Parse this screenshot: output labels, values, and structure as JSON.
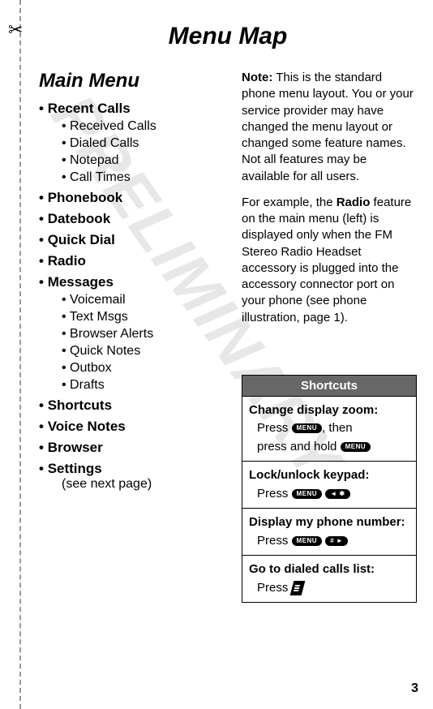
{
  "title": "Menu Map",
  "watermark": "PRELIMINARY",
  "main_heading": "Main Menu",
  "menu": [
    {
      "label": "Recent Calls",
      "sub": [
        "Received Calls",
        "Dialed Calls",
        "Notepad",
        "Call Times"
      ]
    },
    {
      "label": "Phonebook"
    },
    {
      "label": "Datebook"
    },
    {
      "label": "Quick Dial"
    },
    {
      "label": "Radio"
    },
    {
      "label": "Messages",
      "sub": [
        "Voicemail",
        "Text Msgs",
        "Browser Alerts",
        "Quick Notes",
        "Outbox",
        "Drafts"
      ]
    },
    {
      "label": "Shortcuts"
    },
    {
      "label": "Voice Notes"
    },
    {
      "label": "Browser"
    },
    {
      "label": "Settings",
      "note": "(see next page)"
    }
  ],
  "note_label": "Note:",
  "note_text": " This is the standard phone menu layout. You or your service provider may have changed the menu layout or changed some feature names. Not all features may be available for all users.",
  "feature_prefix": "For example, the ",
  "feature_bold": "Radio",
  "feature_suffix": " feature on the main menu (left) is displayed only when the FM Stereo Radio Headset accessory is plugged into the accessory connector port on your phone (see phone illustration, page 1).",
  "shortcuts": {
    "header": "Shortcuts",
    "items": [
      {
        "title": "Change display zoom:",
        "line1_pre": "Press ",
        "key1": "MENU",
        "line1_post": ", then",
        "line2_pre": "press and hold ",
        "key2": "MENU"
      },
      {
        "title": "Lock/unlock keypad:",
        "line1_pre": "Press ",
        "key1": "MENU",
        "key2": "◄ ✱"
      },
      {
        "title": "Display my phone number:",
        "line1_pre": "Press ",
        "key1": "MENU",
        "key2": "# ►"
      },
      {
        "title": "Go to dialed calls list:",
        "line1_pre": "Press ",
        "send": true
      }
    ]
  },
  "page_number": "3"
}
